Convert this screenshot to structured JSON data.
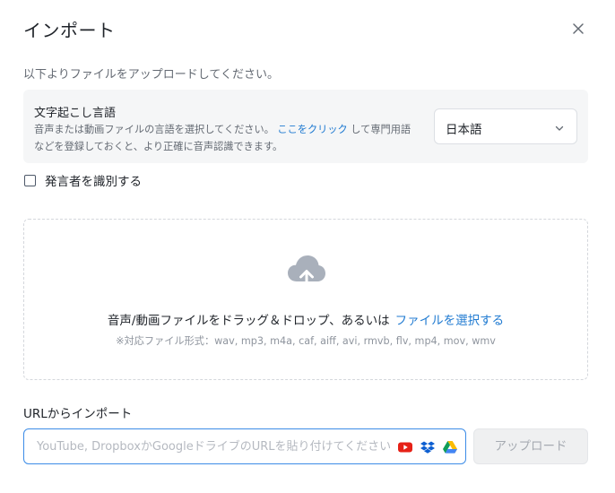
{
  "dialog": {
    "title": "インポート",
    "close_icon": "close-icon",
    "subtitle": "以下よりファイルをアップロードしてください。"
  },
  "language": {
    "title": "文字起こし言語",
    "desc_before": "音声または動画ファイルの言語を選択してください。",
    "desc_link": "ここをクリック",
    "desc_after": "して専門用語などを登録しておくと、より正確に音声認識できます。",
    "selected": "日本語",
    "chevron_icon": "chevron-down-icon"
  },
  "speaker": {
    "label": "発言者を識別する",
    "checked": false
  },
  "dropzone": {
    "icon": "cloud-upload-icon",
    "main_text": "音声/動画ファイルをドラッグ＆ドロップ、あるいは",
    "link_text": "ファイルを選択する",
    "formats": "※対応ファイル形式：wav, mp3, m4a, caf, aiff, avi, rmvb, flv, mp4, mov, wmv"
  },
  "url_import": {
    "label": "URLからインポート",
    "placeholder": "YouTube, DropboxかGoogleドライブのURLを貼り付けてください",
    "value": "",
    "source_icons": [
      "youtube-icon",
      "dropbox-icon",
      "google-drive-icon"
    ],
    "upload_button": "アップロード",
    "upload_enabled": false
  },
  "colors": {
    "accent": "#1f7ad1",
    "input_focus_border": "#3c8ce7",
    "panel_bg": "#f5f6f7",
    "disabled_button_bg": "#eff0f1"
  }
}
